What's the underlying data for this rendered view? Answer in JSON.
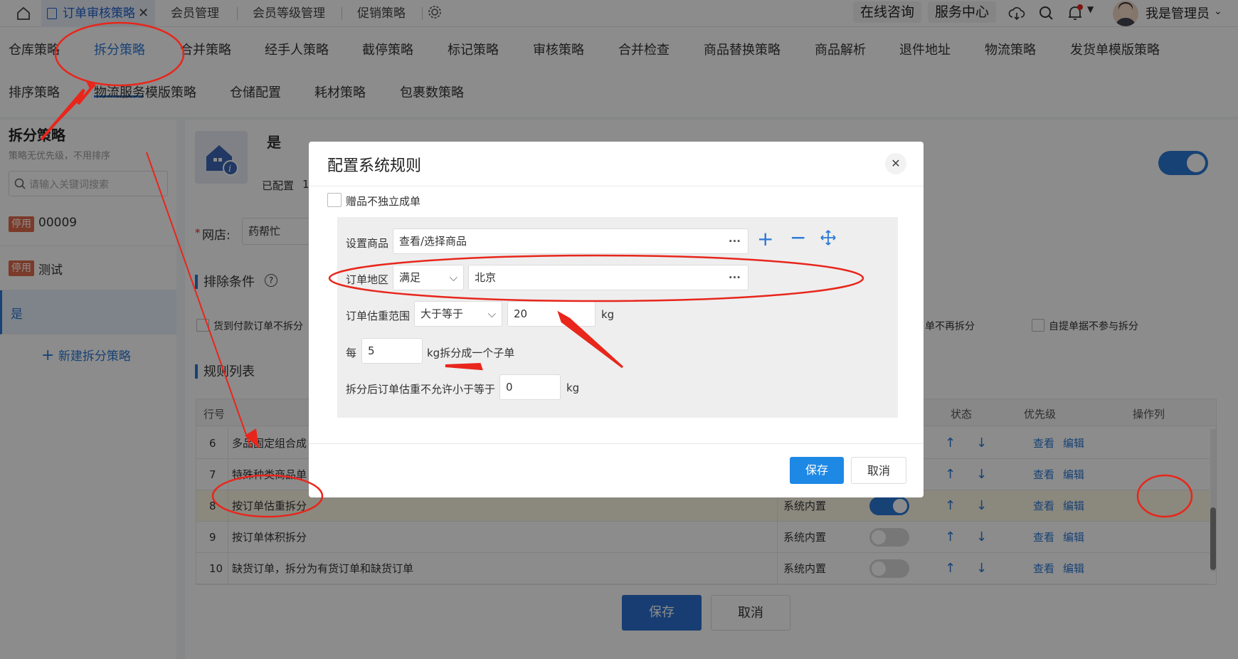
{
  "topbar": {
    "tabs": [
      {
        "label": "订单审核策略",
        "active": true
      },
      {
        "label": "会员管理"
      },
      {
        "label": "会员等级管理"
      },
      {
        "label": "促销策略"
      }
    ],
    "online_consult": "在线咨询",
    "service_center": "服务中心",
    "user_name": "我是管理员"
  },
  "strategy_nav": {
    "row1": [
      "仓库策略",
      "拆分策略",
      "合并策略",
      "经手人策略",
      "截停策略",
      "标记策略",
      "审核策略",
      "合并检查",
      "商品替换策略",
      "商品解析",
      "退件地址",
      "物流策略",
      "发货单模版策略"
    ],
    "row2": [
      "排序策略",
      "物流服务模版策略",
      "仓储配置",
      "耗材策略",
      "包裹数策略"
    ],
    "active": "拆分策略"
  },
  "left_panel": {
    "title": "拆分策略",
    "subtitle": "策略无优先级，不用排序",
    "search_placeholder": "请输入关键词搜索",
    "items": [
      {
        "badge": "停用",
        "name": "00009"
      },
      {
        "badge": "停用",
        "name": "测试"
      },
      {
        "badge": "",
        "name": "是"
      }
    ],
    "new_label": "新建拆分策略"
  },
  "main": {
    "header_name": "是",
    "configured_label": "已配置",
    "configured_count": "1",
    "shop_label": "网店:",
    "shop_value": "药帮忙",
    "exclude_title": "排除条件",
    "exclude_options": [
      "货到付款订单不拆分",
      "单不再拆分",
      "自提单据不参与拆分"
    ],
    "rules_title": "规则列表",
    "table_headers": [
      "行号",
      "状态",
      "优先级",
      "操作列"
    ],
    "rows": [
      {
        "no": "6",
        "name": "多品固定组合成",
        "source": "",
        "enabled": false
      },
      {
        "no": "7",
        "name": "特殊种类商品单",
        "source": "",
        "enabled": false
      },
      {
        "no": "8",
        "name": "按订单估重拆分",
        "source": "系统内置",
        "enabled": true
      },
      {
        "no": "9",
        "name": "按订单体积拆分",
        "source": "系统内置",
        "enabled": false
      },
      {
        "no": "10",
        "name": "缺货订单，拆分为有货订单和缺货订单",
        "source": "系统内置",
        "enabled": false
      }
    ],
    "view_label": "查看",
    "edit_label": "编辑",
    "save_label": "保存",
    "cancel_label": "取消"
  },
  "dialog": {
    "title": "配置系统规则",
    "gift_label": "赠品不独立成单",
    "set_goods_label": "设置商品",
    "set_goods_value": "查看/选择商品",
    "region_label": "订单地区",
    "region_op": "满足",
    "region_value": "北京",
    "weight_label": "订单估重范围",
    "weight_op": "大于等于",
    "weight_value": "20",
    "unit_kg": "kg",
    "per_label": "每",
    "per_value": "5",
    "per_suffix": "kg拆分成一个子单",
    "min_label": "拆分后订单估重不允许小于等于",
    "min_value": "0",
    "save_label": "保存",
    "cancel_label": "取消"
  },
  "colors": {
    "accent": "#2a78d6",
    "annotation": "#e8261b",
    "badge": "#e06b4b"
  }
}
